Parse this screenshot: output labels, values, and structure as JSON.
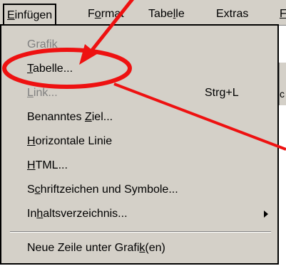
{
  "menubar": {
    "items": [
      {
        "before": "",
        "accel": "E",
        "after": "infügen"
      },
      {
        "before": "F",
        "accel": "o",
        "after": "rmat"
      },
      {
        "before": "Tabe",
        "accel": "l",
        "after": "le"
      },
      {
        "before": "Extras",
        "accel": "",
        "after": ""
      },
      {
        "before": "",
        "accel": "F",
        "after": ""
      }
    ]
  },
  "menu": {
    "items": [
      {
        "before": "Grafik",
        "accel": "",
        "after": "",
        "disabled": true
      },
      {
        "before": "",
        "accel": "T",
        "after": "abelle..."
      },
      {
        "before": "",
        "accel": "L",
        "after": "ink...",
        "disabled": true,
        "shortcut": "Strg+L"
      },
      {
        "before": "Benanntes ",
        "accel": "Z",
        "after": "iel..."
      },
      {
        "before": "",
        "accel": "H",
        "after": "orizontale Linie"
      },
      {
        "before": "",
        "accel": "H",
        "after": "TML..."
      },
      {
        "before": "S",
        "accel": "c",
        "after": "hriftzeichen und Symbole..."
      },
      {
        "before": "In",
        "accel": "h",
        "after": "altsverzeichnis...",
        "submenu": true
      },
      {
        "before": "Neue Zeile unter Grafi",
        "accel": "k",
        "after": "(en)"
      }
    ]
  },
  "edge": {
    "partial_char": "c"
  },
  "colors": {
    "annotation": "#ee1111",
    "menu_bg": "#d4d0c8",
    "disabled_text": "#808080"
  }
}
